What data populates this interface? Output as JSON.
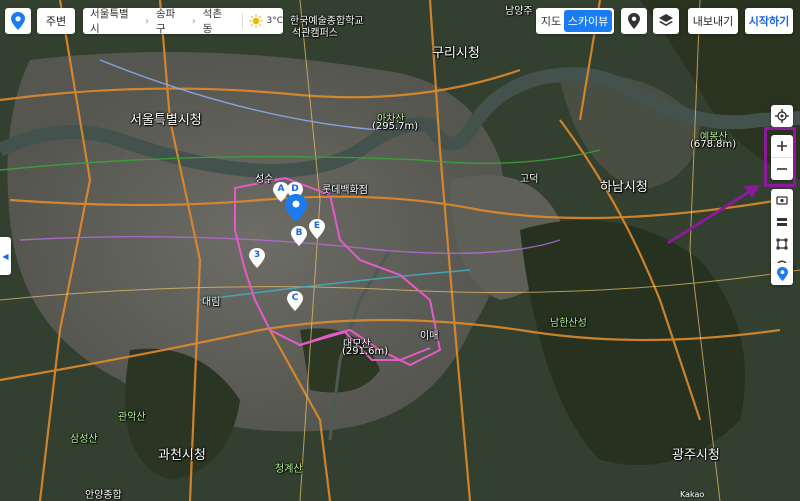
{
  "toolbar": {
    "near_label": "주변",
    "location": [
      "서울특별시",
      "송파구",
      "석촌동"
    ],
    "temperature": "3°C",
    "maptype_map": "지도",
    "maptype_sky": "스카이뷰",
    "export_label": "내보내기",
    "start_label": "시작하기"
  },
  "markers": [
    "A",
    "D",
    "B",
    "E",
    "3",
    "C"
  ],
  "map_labels": [
    {
      "t": "서울특별시청",
      "c": "big"
    },
    {
      "t": "구리시청",
      "c": "big"
    },
    {
      "t": "하남시청",
      "c": "big"
    },
    {
      "t": "과천시청",
      "c": "big"
    },
    {
      "t": "광주시청",
      "c": "big"
    },
    {
      "t": "아차산",
      "c": "green"
    },
    {
      "t": "(295.7m)",
      "c": ""
    },
    {
      "t": "예봉산",
      "c": "green"
    },
    {
      "t": "(678.8m)",
      "c": ""
    },
    {
      "t": "남한산성",
      "c": "green"
    },
    {
      "t": "대모산",
      "c": ""
    },
    {
      "t": "(291.6m)",
      "c": ""
    },
    {
      "t": "롯데백화점",
      "c": ""
    },
    {
      "t": "한국예술종합학교",
      "c": ""
    },
    {
      "t": "석관캠퍼스",
      "c": ""
    },
    {
      "t": "고덕",
      "c": ""
    },
    {
      "t": "대림",
      "c": ""
    },
    {
      "t": "관악산",
      "c": "green"
    },
    {
      "t": "삼성산",
      "c": "green"
    },
    {
      "t": "청계산",
      "c": "green"
    },
    {
      "t": "성수",
      "c": ""
    },
    {
      "t": "이매",
      "c": ""
    },
    {
      "t": "안양종합",
      "c": ""
    },
    {
      "t": "남양주",
      "c": ""
    }
  ],
  "attribution": "Kakao",
  "icons": {
    "logo": "map-pin-logo-icon",
    "weather": "sun-icon",
    "pin": "place-pin-icon",
    "layers": "layers-icon",
    "locate": "crosshair-icon",
    "zoom_in": "plus-icon",
    "zoom_out": "minus-icon",
    "roadview": "roadview-icon",
    "distance": "distance-icon",
    "area": "area-icon",
    "radius": "radius-icon",
    "collapse": "chevron-left-icon"
  }
}
